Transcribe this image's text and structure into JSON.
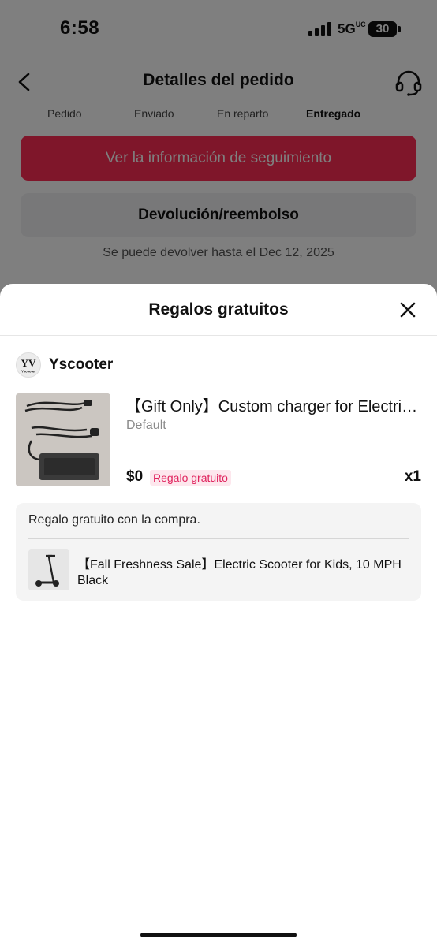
{
  "status_bar": {
    "time": "6:58",
    "network": "5G",
    "network_suffix": "UC",
    "battery": "30"
  },
  "nav": {
    "title": "Detalles del pedido",
    "back_icon": "chevron-left-icon",
    "support_icon": "headset-icon"
  },
  "progress": {
    "steps": [
      "Pedido",
      "Enviado",
      "En reparto",
      "Entregado"
    ],
    "active_step": "Entregado"
  },
  "actions": {
    "tracking_label": "Ver la información de seguimiento",
    "refund_label": "Devolución/reembolso",
    "return_note": "Se puede devolver hasta el Dec 12, 2025"
  },
  "sheet": {
    "title": "Regalos gratuitos",
    "close_icon": "close-icon",
    "shop": {
      "name": "Yscooter",
      "logo_text": "Yscooter"
    },
    "gift_item": {
      "title": "【Gift Only】Custom charger for Electric Scooter",
      "variant": "Default",
      "price": "$0",
      "badge": "Regalo gratuito",
      "quantity": "x1"
    },
    "purchase": {
      "label": "Regalo gratuito con la compra.",
      "title": "【Fall Freshness Sale】Electric Scooter for Kids, 10 MPH",
      "variant": "Black"
    }
  },
  "colors": {
    "accent": "#fe2c55",
    "badge_bg": "#fde7ed",
    "badge_text": "#e0245e",
    "overlay": "rgba(0,0,0,0.5)"
  }
}
